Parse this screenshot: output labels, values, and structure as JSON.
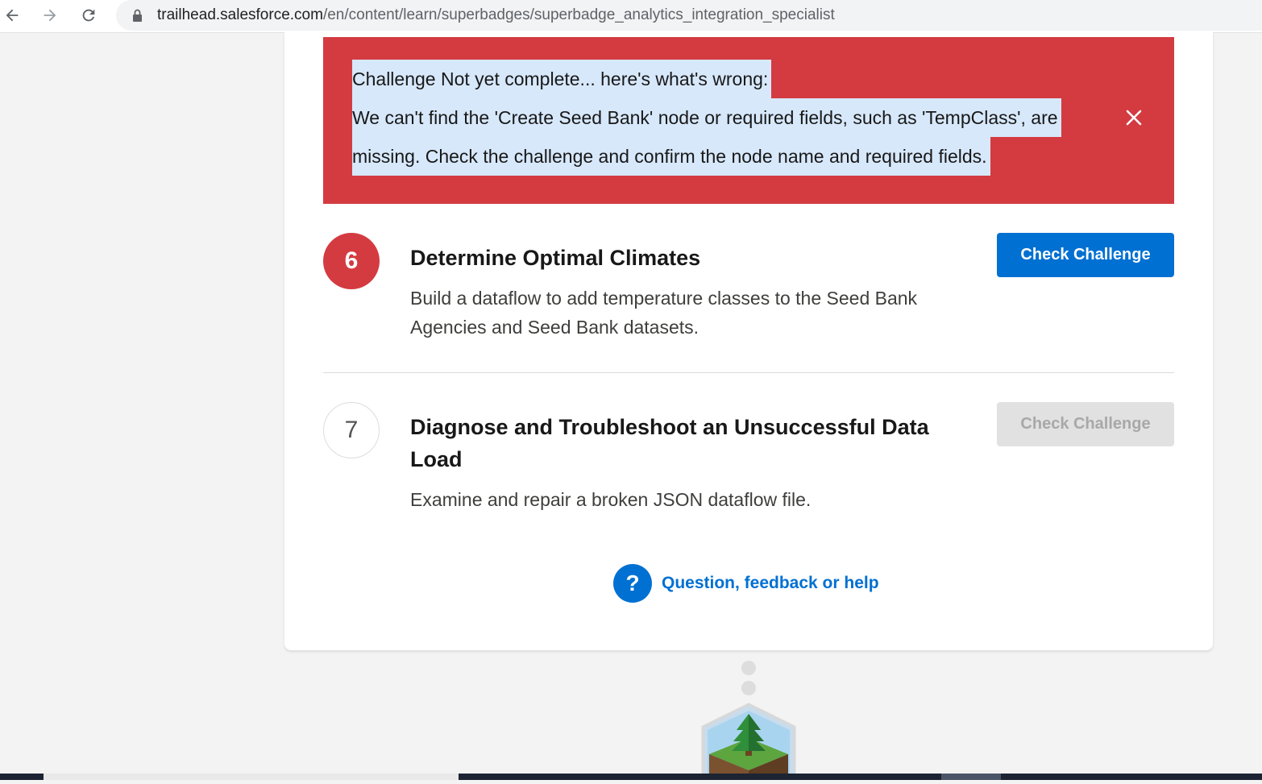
{
  "browser": {
    "url_host": "trailhead.salesforce.com",
    "url_path": "/en/content/learn/superbadges/superbadge_analytics_integration_specialist",
    "icons": [
      "back-arrow-icon",
      "forward-arrow-icon",
      "reload-icon",
      "lock-icon"
    ]
  },
  "error_banner": {
    "line1": "Challenge Not yet complete... here's what's wrong:",
    "line2": "We can't find the 'Create Seed Bank' node or required fields, such as 'TempClass', are",
    "line3": "missing. Check the challenge and confirm the node name and required fields.",
    "background": "#d33b41",
    "close_icon": "close-icon"
  },
  "steps": [
    {
      "number": "6",
      "title": "Determine Optimal Climates",
      "description": "Build a dataflow to add temperature classes to the Seed Bank Agencies and Seed Bank datasets.",
      "button_label": "Check Challenge",
      "button_state": "enabled"
    },
    {
      "number": "7",
      "title": "Diagnose and Troubleshoot an Unsuccessful Data Load",
      "description": "Examine and repair a broken JSON dataflow file.",
      "button_label": "Check Challenge",
      "button_state": "disabled"
    }
  ],
  "help": {
    "icon_glyph": "?",
    "label": "Question, feedback or help"
  },
  "badge_icon": "tree-badge-icon",
  "colors": {
    "accent": "#0070d2",
    "error": "#d33b41",
    "selection": "#d7e8fb"
  }
}
